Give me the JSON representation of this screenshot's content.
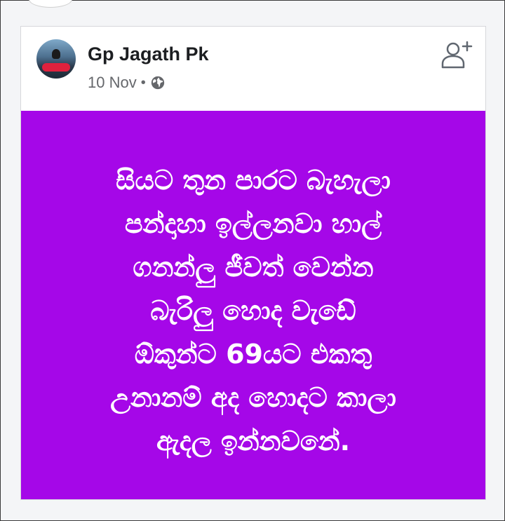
{
  "post": {
    "author": "Gp Jagath Pk",
    "date": "10 Nov",
    "separator": "•",
    "privacy_icon": "globe-icon",
    "action_icon": "add-friend-icon",
    "background_color": "#a507e8",
    "text_color": "#ffffff",
    "text_lines": [
      "සියට තුන පාරට බැහැලා",
      "පන්දාහා ඉල්ලනවා හාල්",
      "ගනන්ලු ජීවත් වෙන්න",
      "බැරිලු හොද වැඩේ",
      "ඕකුන්ට 69යට එකතු",
      "උනානම් අද හොදට කාලා",
      "ඇදල ඉන්නවනේ."
    ]
  }
}
